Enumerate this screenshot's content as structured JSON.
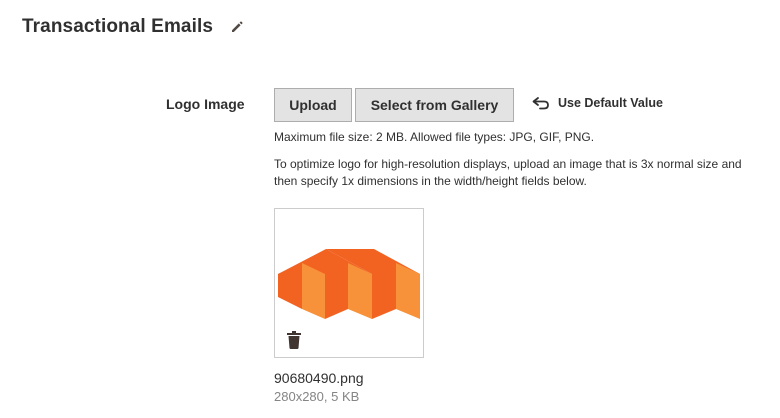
{
  "section": {
    "title": "Transactional Emails",
    "edit_icon": "pencil-icon"
  },
  "field": {
    "label": "Logo Image",
    "upload_label": "Upload",
    "gallery_label": "Select from Gallery",
    "use_default_label": "Use Default Value",
    "use_default_icon": "undo-icon"
  },
  "notes": {
    "file_limits": "Maximum file size: 2 MB. Allowed file types: JPG, GIF, PNG.",
    "hires_hint": "To optimize logo for high-resolution displays, upload an image that is 3x normal size and then specify 1x dimensions in the width/height fields below."
  },
  "image": {
    "file_name": "90680490.png",
    "meta": "280x280, 5 KB",
    "delete_icon": "trash-icon"
  },
  "colors": {
    "logo_orange": "#f26322",
    "logo_orange_light": "#f7923a",
    "button_bg": "#e3e3e3",
    "meta_gray": "#858585"
  }
}
